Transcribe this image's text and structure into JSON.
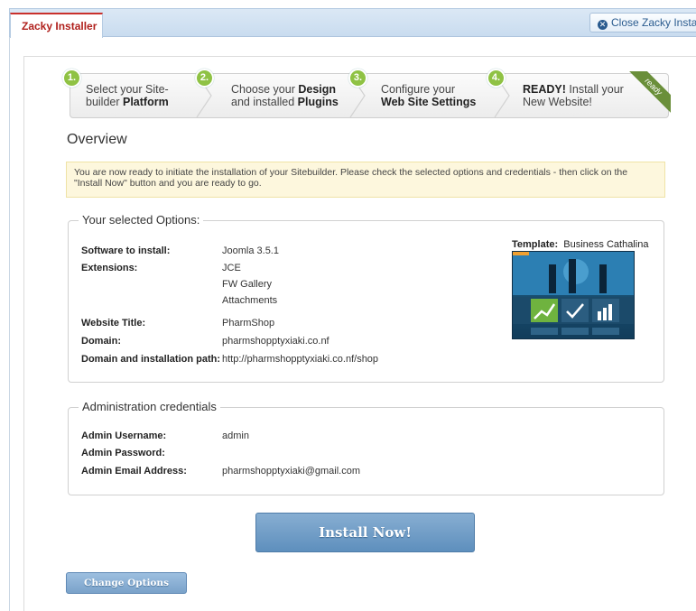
{
  "tabs": {
    "active_label": "Zacky Installer",
    "close_label": "Close Zacky Installer"
  },
  "steps": [
    {
      "number": "1.",
      "line1": "Select your Site-",
      "line2_pre": "builder ",
      "line2_bold": "Platform",
      "line1_bold": ""
    },
    {
      "number": "2.",
      "line1_pre": "Choose your ",
      "line1_bold": "Design",
      "line2_pre": "and installed ",
      "line2_bold": "Plugins"
    },
    {
      "number": "3.",
      "line1": "Configure your",
      "line2_bold": "Web Site Settings"
    },
    {
      "number": "4.",
      "line1_bold": "READY!",
      "line1_post": " Install your",
      "line2": "New Website!"
    }
  ],
  "ribbon_label": "ready",
  "overview": {
    "title": "Overview",
    "notice": "You are now ready to initiate the installation of your Sitebuilder. Please check the selected options and credentials - then click on the \"Install Now\" button and you are ready to go."
  },
  "options": {
    "legend": "Your selected Options:",
    "software_label": "Software to install:",
    "software_value": "Joomla 3.5.1",
    "extensions_label": "Extensions:",
    "extensions": [
      "JCE",
      "FW Gallery",
      "Attachments"
    ],
    "title_label": "Website Title:",
    "title_value": "PharmShop",
    "domain_label": "Domain:",
    "domain_value": "pharmshopptyxiaki.co.nf",
    "path_label": "Domain and installation path:",
    "path_value": "http://pharmshopptyxiaki.co.nf/shop",
    "template_label": "Template:",
    "template_value": "Business Cathalina"
  },
  "credentials": {
    "legend": "Administration credentials",
    "username_label": "Admin Username:",
    "username_value": "admin",
    "password_label": "Admin Password:",
    "password_value": "",
    "email_label": "Admin Email Address:",
    "email_value": "pharmshopptyxiaki@gmail.com"
  },
  "buttons": {
    "install": "Install Now!",
    "change": "Change Options"
  },
  "colors": {
    "accent": "#5e8fbd",
    "step_badge": "#8fc244",
    "tab_active": "#b0201c",
    "notice_bg": "#fdf7dd"
  }
}
